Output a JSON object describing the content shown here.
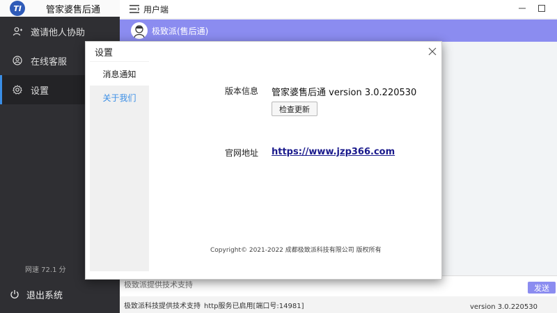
{
  "app": {
    "title": "管家婆售后通",
    "logo_text": "TI"
  },
  "sidebar": {
    "items": [
      {
        "label": "邀请他人协助",
        "icon": "user-add-icon"
      },
      {
        "label": "在线客服",
        "icon": "headset-icon"
      },
      {
        "label": "设置",
        "icon": "gear-icon",
        "active": true
      }
    ],
    "net_speed": "网速 72.1 分",
    "logout_label": "退出系统"
  },
  "topbar": {
    "client_label": "用户端"
  },
  "chat": {
    "contact_name": "极致派(售后通)",
    "input_placeholder": "极致派提供技术支持",
    "send_label": "发送"
  },
  "status_bar": {
    "support_text": "极致派科技提供技术支持",
    "http_text": "http服务已启用[端口号:14981]",
    "version_text": "version 3.0.220530"
  },
  "dialog": {
    "title": "设置",
    "tabs": [
      {
        "label": "消息通知",
        "active": true
      },
      {
        "label": "关于我们",
        "active": false
      }
    ],
    "version_label": "版本信息",
    "version_value": "管家婆售后通 version 3.0.220530",
    "check_update_label": "检查更新",
    "website_label": "官网地址",
    "website_url": "https://www.jzp366.com",
    "copyright": "Copyright© 2021-2022 成都极致派科技有限公司 版权所有"
  },
  "colors": {
    "accent": "#8b8cf0",
    "sidebar_bg": "#2f2f33",
    "active_indicator": "#3a8ee6",
    "link": "#1a1a8c"
  }
}
